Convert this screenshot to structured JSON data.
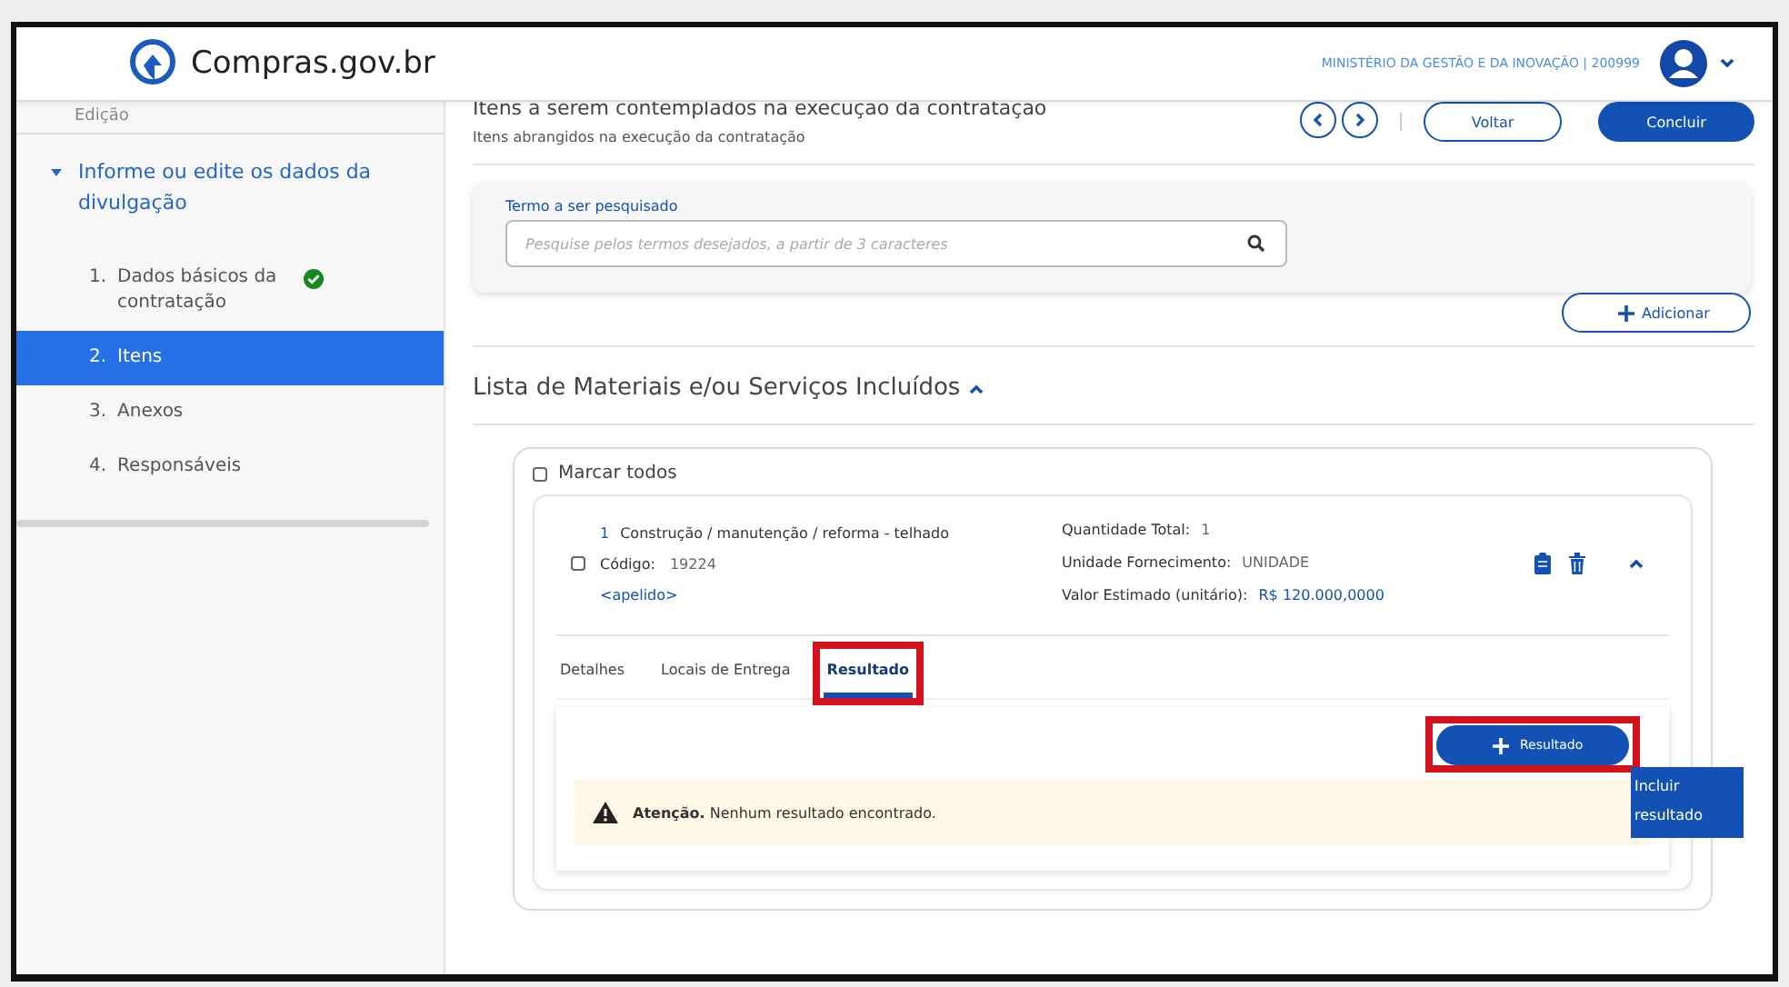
{
  "header": {
    "logo": "Compras.gov.br",
    "org": "MINISTÉRIO DA GESTÃO E DA INOVAÇÃO | 200999"
  },
  "sidebar": {
    "section": "Edição",
    "group": {
      "label": "Informe ou edite os dados da divulgação",
      "expanded": true
    },
    "items": [
      {
        "number": "1.",
        "label": "Dados básicos da contratação",
        "done": true,
        "selected": false
      },
      {
        "number": "2.",
        "label": "Itens",
        "done": false,
        "selected": true
      },
      {
        "number": "3.",
        "label": "Anexos",
        "done": false,
        "selected": false
      },
      {
        "number": "4.",
        "label": "Responsáveis",
        "done": false,
        "selected": false
      }
    ]
  },
  "page": {
    "title": "Itens a serem contemplados na execução da contratação",
    "subtitle": "Itens abrangidos na execução da contratação",
    "back_button": "Voltar",
    "finish_button": "Concluir"
  },
  "search": {
    "label": "Termo a ser pesquisado",
    "placeholder": "Pesquise pelos termos desejados, a partir de 3 caracteres"
  },
  "add_button": "Adicionar",
  "list": {
    "title": "Lista de Materiais e/ou Serviços Incluídos",
    "expanded": true,
    "select_all": {
      "label": "Marcar todos",
      "checked": false
    }
  },
  "item": {
    "checked": false,
    "number": "1",
    "name": "Construção / manutenção / reforma - telhado",
    "code_label": "Código:",
    "code": "19224",
    "nickname": "<apelido>",
    "expanded": true,
    "fields": [
      {
        "label": "Quantidade Total:",
        "value": "1",
        "highlight": false
      },
      {
        "label": "Unidade Fornecimento:",
        "value": "UNIDADE",
        "highlight": false
      },
      {
        "label": "Valor Estimado (unitário):",
        "value": "R$ 120.000,0000",
        "highlight": true
      }
    ],
    "tabs": [
      {
        "label": "Detalhes",
        "selected": false,
        "annotated": false
      },
      {
        "label": "Locais de Entrega",
        "selected": false,
        "annotated": false
      },
      {
        "label": "Resultado",
        "selected": true,
        "annotated": true
      }
    ],
    "result_button": {
      "label": "Resultado",
      "annotated": true
    },
    "alert": {
      "text": "**Atenção.** Nenhum resultado encontrado."
    }
  },
  "tooltip": "Incluir resultado"
}
